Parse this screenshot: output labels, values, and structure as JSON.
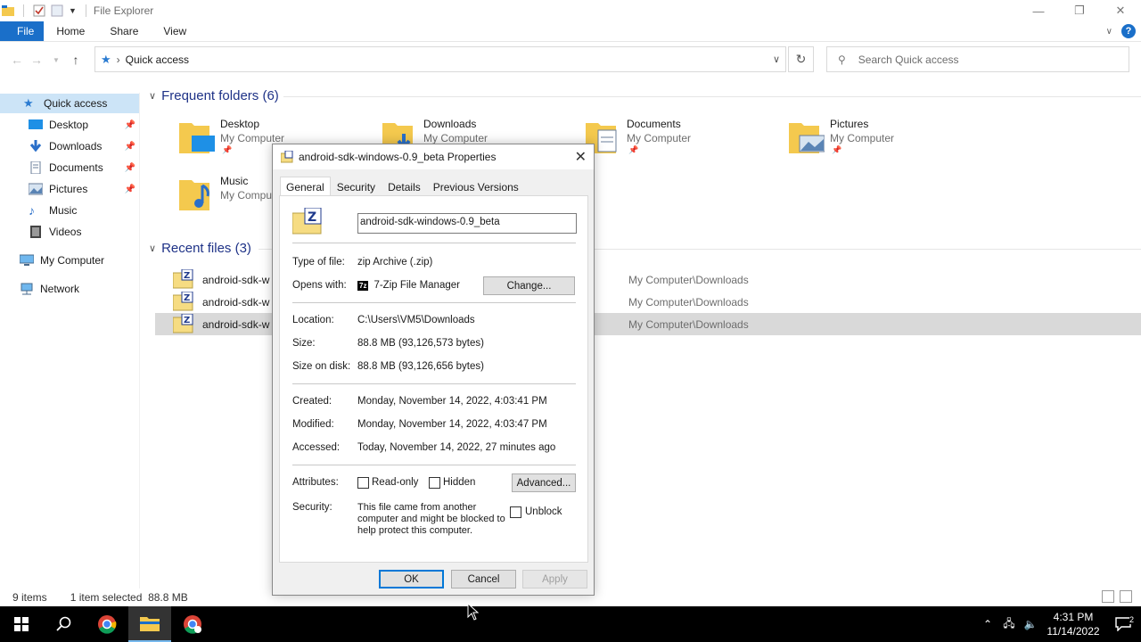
{
  "window": {
    "title": "File Explorer"
  },
  "ribbon": {
    "tabs": [
      "File",
      "Home",
      "Share",
      "View"
    ]
  },
  "address": {
    "crumb": "Quick access",
    "search_placeholder": "Search Quick access"
  },
  "sidebar": {
    "items": [
      {
        "label": "Quick access",
        "icon": "star-icon"
      },
      {
        "label": "Desktop",
        "icon": "desktop-icon",
        "pinned": true
      },
      {
        "label": "Downloads",
        "icon": "download-icon",
        "pinned": true
      },
      {
        "label": "Documents",
        "icon": "documents-icon",
        "pinned": true
      },
      {
        "label": "Pictures",
        "icon": "pictures-icon",
        "pinned": true
      },
      {
        "label": "Music",
        "icon": "music-icon"
      },
      {
        "label": "Videos",
        "icon": "videos-icon"
      },
      {
        "label": "My Computer",
        "icon": "computer-icon"
      },
      {
        "label": "Network",
        "icon": "network-icon"
      }
    ]
  },
  "frequent": {
    "header": "Frequent folders (6)",
    "folders": [
      {
        "name": "Desktop",
        "location": "My Computer"
      },
      {
        "name": "Downloads",
        "location": "My Computer"
      },
      {
        "name": "Documents",
        "location": "My Computer"
      },
      {
        "name": "Pictures",
        "location": "My Computer"
      },
      {
        "name": "Music",
        "location": "My Compu"
      }
    ]
  },
  "recent": {
    "header": "Recent files (3)",
    "files": [
      {
        "name": "android-sdk-w",
        "path": "My Computer\\Downloads"
      },
      {
        "name": "android-sdk-w",
        "path": "My Computer\\Downloads"
      },
      {
        "name": "android-sdk-w",
        "path": "My Computer\\Downloads"
      }
    ]
  },
  "status": {
    "items": "9 items",
    "selected": "1 item selected  88.8 MB"
  },
  "dialog": {
    "title": "android-sdk-windows-0.9_beta Properties",
    "tabs": [
      "General",
      "Security",
      "Details",
      "Previous Versions"
    ],
    "filename": "android-sdk-windows-0.9_beta",
    "type_label": "Type of file:",
    "type_value": "zip Archive (.zip)",
    "opens_label": "Opens with:",
    "opens_value": "7-Zip File Manager",
    "change_button": "Change...",
    "location_label": "Location:",
    "location_value": "C:\\Users\\VM5\\Downloads",
    "size_label": "Size:",
    "size_value": "88.8 MB (93,126,573 bytes)",
    "disk_label": "Size on disk:",
    "disk_value": "88.8 MB (93,126,656 bytes)",
    "created_label": "Created:",
    "created_value": "Monday, November 14, 2022, 4:03:41 PM",
    "modified_label": "Modified:",
    "modified_value": "Monday, November 14, 2022, 4:03:47 PM",
    "accessed_label": "Accessed:",
    "accessed_value": "Today, November 14, 2022, 27 minutes ago",
    "attributes_label": "Attributes:",
    "readonly_label": "Read-only",
    "hidden_label": "Hidden",
    "advanced_button": "Advanced...",
    "security_label": "Security:",
    "security_text_1": "This file came from another",
    "security_text_2": "computer and might be blocked to",
    "security_text_3": "help protect this computer.",
    "unblock_label": "Unblock",
    "ok_button": "OK",
    "cancel_button": "Cancel",
    "apply_button": "Apply"
  },
  "taskbar": {
    "time": "4:31 PM",
    "date": "11/14/2022",
    "notifications": "2"
  },
  "colors": {
    "accent": "#1a6fc9",
    "folder": "#f4c94e",
    "selection": "#cce4f7"
  }
}
